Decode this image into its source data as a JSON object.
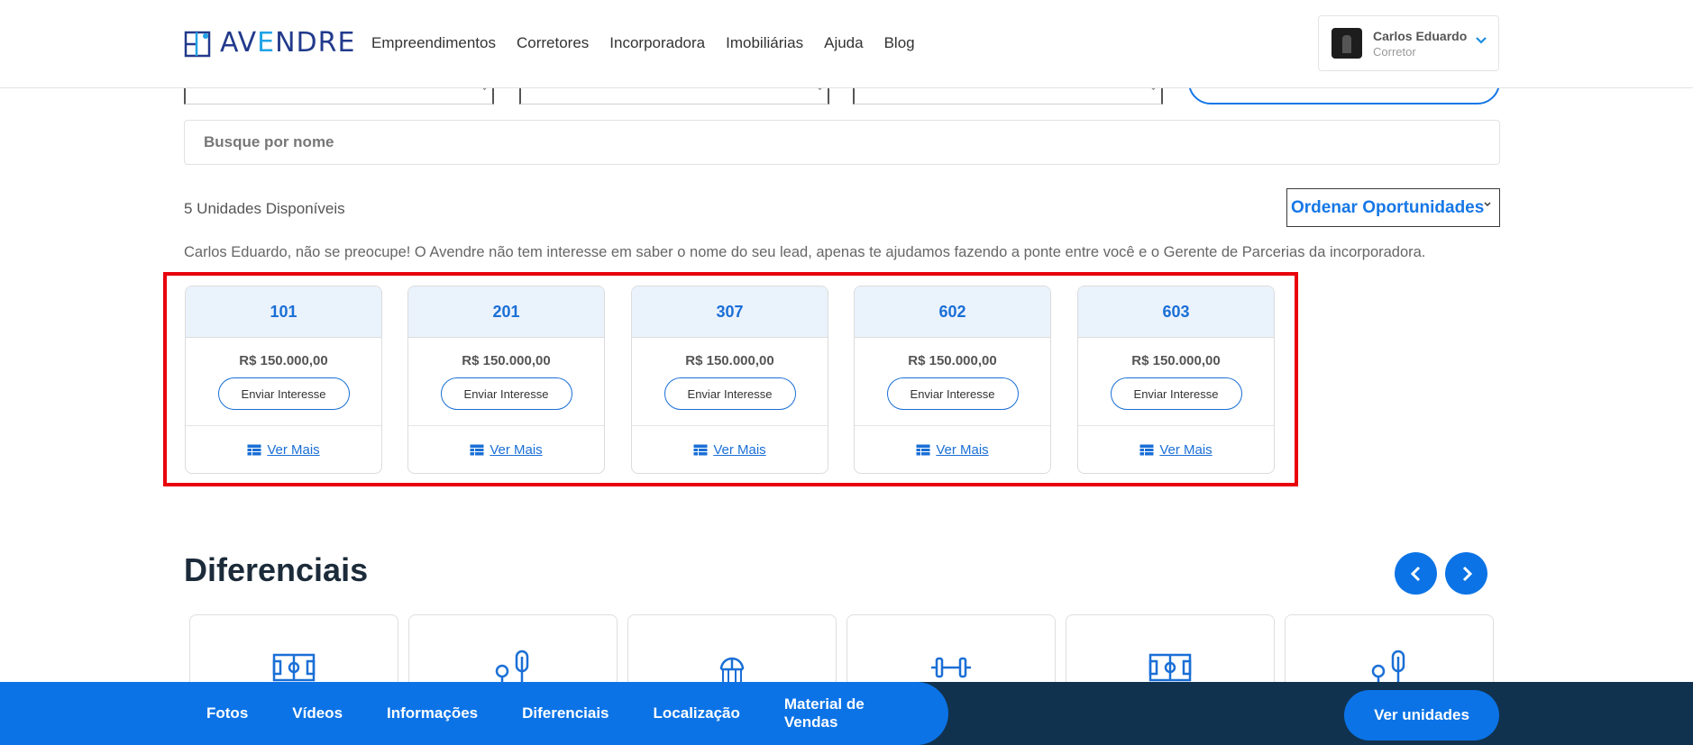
{
  "header": {
    "logo_text_a": "AV",
    "logo_text_b": "E",
    "logo_text_c": "NDRE",
    "nav": [
      "Empreendimentos",
      "Corretores",
      "Incorporadora",
      "Imobiliárias",
      "Ajuda",
      "Blog"
    ],
    "user": {
      "name": "Carlos Eduardo",
      "role": "Corretor"
    }
  },
  "search": {
    "placeholder": "Busque por nome"
  },
  "results": {
    "count_label": "5 Unidades Disponíveis",
    "sort_label": "Ordenar Oportunidades",
    "notice": "Carlos Eduardo, não se preocupe! O Avendre não tem interesse em saber o nome do seu lead, apenas te ajudamos fazendo a ponte entre você e o Gerente de Parcerias da incorporadora."
  },
  "units": [
    {
      "number": "101",
      "price": "R$ 150.000,00",
      "button": "Enviar Interesse",
      "link": "Ver Mais"
    },
    {
      "number": "201",
      "price": "R$ 150.000,00",
      "button": "Enviar Interesse",
      "link": "Ver Mais"
    },
    {
      "number": "307",
      "price": "R$ 150.000,00",
      "button": "Enviar Interesse",
      "link": "Ver Mais"
    },
    {
      "number": "602",
      "price": "R$ 150.000,00",
      "button": "Enviar Interesse",
      "link": "Ver Mais"
    },
    {
      "number": "603",
      "price": "R$ 150.000,00",
      "button": "Enviar Interesse",
      "link": "Ver Mais"
    }
  ],
  "diferenciais": {
    "title": "Diferenciais",
    "icons": [
      "sports-court-icon",
      "playground-icon",
      "gazebo-icon",
      "gym-icon",
      "sports-court-icon",
      "playground-icon"
    ]
  },
  "bottom_bar": {
    "tabs": [
      "Fotos",
      "Vídeos",
      "Informações",
      "Diferenciais",
      "Localização",
      "Material de Vendas"
    ],
    "cta": "Ver unidades"
  },
  "colors": {
    "primary": "#0b73e6",
    "dark": "#11324e",
    "highlight": "#e8000b"
  }
}
